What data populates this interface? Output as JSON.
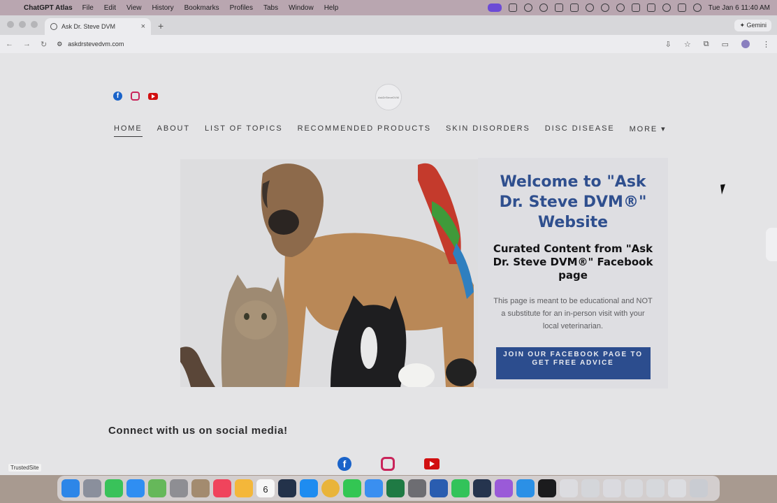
{
  "menubar": {
    "app_name": "ChatGPT Atlas",
    "items": [
      "File",
      "Edit",
      "View",
      "History",
      "Bookmarks",
      "Profiles",
      "Tabs",
      "Window",
      "Help"
    ],
    "clock": "Tue Jan 6  11:40 AM"
  },
  "browser": {
    "tab_title": "Ask Dr. Steve DVM",
    "url": "askdrstevedvm.com",
    "gemini_label": "Gemini",
    "avatar_letter": "L"
  },
  "site": {
    "nav": [
      "HOME",
      "ABOUT",
      "LIST OF TOPICS",
      "RECOMMENDED PRODUCTS",
      "SKIN DISORDERS",
      "DISC DISEASE",
      "MORE ▾"
    ],
    "active_nav": "HOME",
    "welcome_title": "Welcome to \"Ask Dr. Steve DVM®\" Website",
    "welcome_subtitle": "Curated Content from \"Ask Dr. Steve DVM®\" Facebook page",
    "welcome_body": "This page is meant to be educational and NOT a substitute for an in-person visit with your local veterinarian.",
    "cta_label": "JOIN OUR FACEBOOK PAGE TO GET FREE ADVICE",
    "connect_heading": "Connect with us on social media!",
    "trusted_badge": "TrustedSite"
  },
  "colors": {
    "brand_blue": "#2c4d8e",
    "title_blue": "#2f4f8e",
    "facebook": "#1a63c9",
    "instagram": "#c9245a",
    "youtube": "#d10f10"
  },
  "icons": {
    "social": [
      "facebook-icon",
      "instagram-icon",
      "youtube-icon"
    ]
  },
  "dock": {
    "calendar_day": "6",
    "apps": [
      "finder-icon",
      "launchpad-icon",
      "facetime-icon",
      "app-store-icon",
      "maps-icon",
      "settings-icon",
      "contacts-icon",
      "music-icon",
      "photos-icon",
      "calendar-icon",
      "telegram-icon",
      "safari-icon",
      "chrome-icon",
      "messages-icon",
      "mail-icon",
      "excel-icon",
      "calculator-icon",
      "word-icon",
      "whatsapp-icon",
      "telegram-alt-icon",
      "podcasts-icon",
      "q-app-icon",
      "chatgpt-icon",
      "window-1-icon",
      "window-2-icon",
      "window-3-icon",
      "window-4-icon",
      "window-5-icon",
      "window-6-icon",
      "trash-icon"
    ]
  }
}
